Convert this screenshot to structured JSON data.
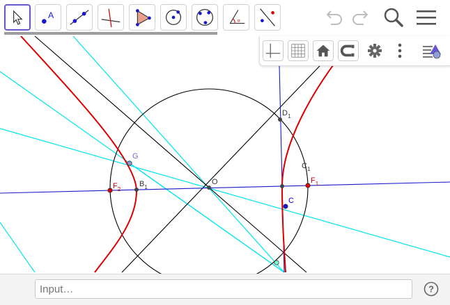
{
  "colors": {
    "accent": "#6557d2",
    "hyperbola": "#dd0000",
    "cyan_line": "#00e5ee",
    "blue_line": "#1a1acc",
    "black_line": "#000000",
    "point_fill": "#444444",
    "focus_fill": "#dd0000",
    "label_red": "#cc0000",
    "label_blue": "#0000cc",
    "label_gray": "#555555"
  },
  "toolbar": {
    "tools": [
      {
        "name": "move-tool-button",
        "icon": "cursor-arrow-icon"
      },
      {
        "name": "point-tool-button",
        "icon": "point-a-icon"
      },
      {
        "name": "line-tool-button",
        "icon": "line-through-points-icon"
      },
      {
        "name": "perpendicular-line-tool-button",
        "icon": "perpendicular-line-icon"
      },
      {
        "name": "polygon-tool-button",
        "icon": "polygon-icon"
      },
      {
        "name": "circle-center-point-tool-button",
        "icon": "circle-center-icon"
      },
      {
        "name": "circle-three-points-tool-button",
        "icon": "circle-three-points-icon"
      },
      {
        "name": "angle-tool-button",
        "icon": "angle-icon"
      },
      {
        "name": "reflect-tool-button",
        "icon": "reflect-about-line-icon"
      }
    ],
    "undo_icon": "undo-icon",
    "redo_icon": "redo-icon",
    "search_icon": "search-icon",
    "menu_icon": "hamburger-menu-icon"
  },
  "style_bar": {
    "axes_icon": "axes-icon",
    "grid_icon": "grid-icon",
    "home_icon": "home-icon",
    "snap_icon": "magnet-snap-icon",
    "settings_icon": "gear-icon",
    "more_icon": "more-vertical-icon",
    "toggle_icon": "style-bar-toggle-icon"
  },
  "labels": {
    "D1": {
      "main": "D",
      "sub": "1"
    },
    "C1": {
      "main": "C",
      "sub": "1"
    },
    "F1": {
      "main": "F",
      "sub": "1"
    },
    "F2": {
      "main": "F",
      "sub": "2"
    },
    "B1": {
      "main": "B",
      "sub": "1"
    },
    "G": "G",
    "O": "O",
    "C": "C"
  },
  "input_bar": {
    "placeholder": "Input…",
    "help_icon": "help-icon"
  }
}
